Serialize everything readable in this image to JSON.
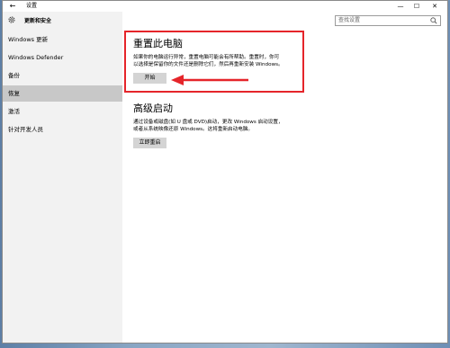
{
  "window": {
    "back_glyph": "←",
    "title": "设置",
    "min_glyph": "—",
    "max_glyph": "☐",
    "close_glyph": "✕"
  },
  "sidebar": {
    "header_label": "更新和安全",
    "items": [
      {
        "label": "Windows 更新"
      },
      {
        "label": "Windows Defender"
      },
      {
        "label": "备份"
      },
      {
        "label": "恢复",
        "selected": true
      },
      {
        "label": "激活"
      },
      {
        "label": "针对开发人员"
      }
    ]
  },
  "search": {
    "placeholder": "查找设置"
  },
  "reset": {
    "title": "重置此电脑",
    "desc_line1": "如果你的电脑运行异常，重置电脑可能会有所帮助。重置时，你可",
    "desc_line2": "以选择是保留你的文件还是删除它们，然后再重新安装 Windows。",
    "button_label": "开始"
  },
  "advanced": {
    "title": "高级启动",
    "desc_line1": "通过设备或磁盘(如 U 盘或 DVD)启动，更改 Windows 启动设置，",
    "desc_line2": "或者从系统映像还原 Windows。这将重新启动电脑。",
    "button_label": "立即重启"
  },
  "colors": {
    "highlight": "#e5252a",
    "sidebar_bg": "#f2f2f2",
    "selected_bg": "#c8c8c8",
    "button_bg": "#d4d4d4"
  }
}
